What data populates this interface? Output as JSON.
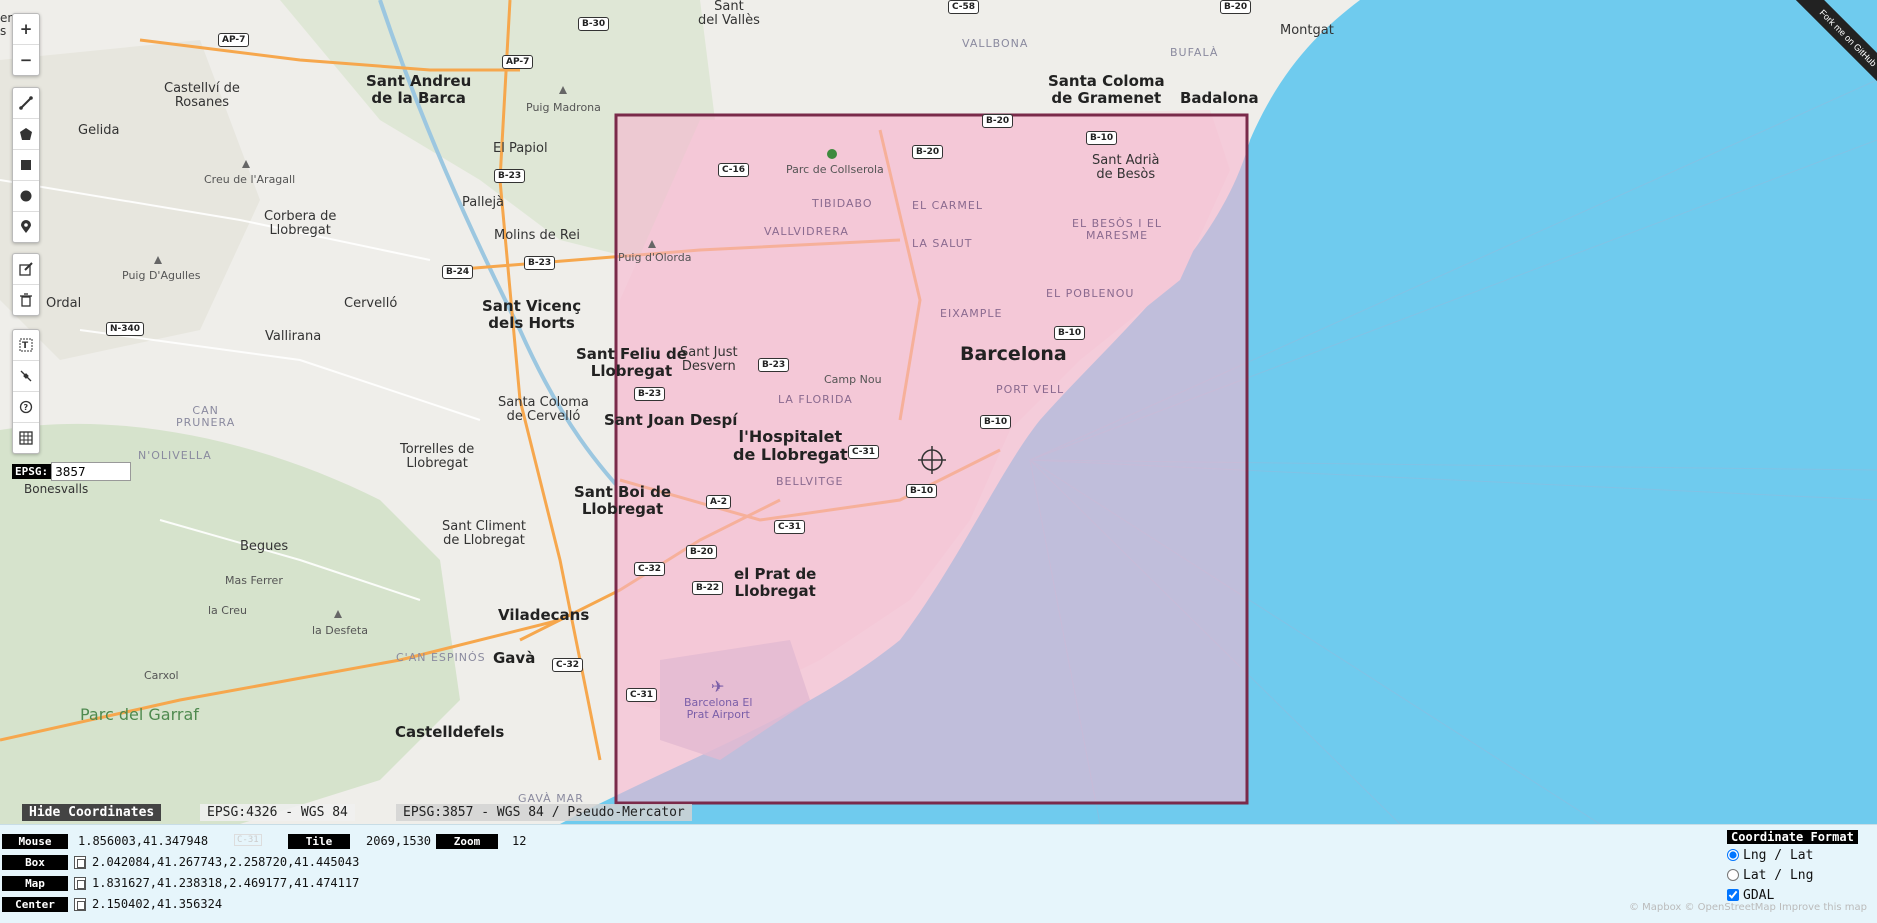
{
  "ribbon": "Fork me on GitHub",
  "zoom_controls": {
    "zoom_in": "+",
    "zoom_out": "−"
  },
  "toolbar_icons": [
    "polyline-icon",
    "polygon-icon",
    "rectangle-icon",
    "circle-icon",
    "marker-icon",
    "edit-icon",
    "trash-icon",
    "text-box-icon",
    "satellite-icon",
    "help-icon",
    "grid-icon"
  ],
  "epsg": {
    "label": "EPSG:",
    "value": "3857"
  },
  "map": {
    "places": {
      "sant_andreu": "Sant Andreu\nde la Barca",
      "castellvi": "Castellví de\nRosanes",
      "gelida": "Gelida",
      "puig_madrona": "Puig Madrona",
      "el_papiol": "El Papiol",
      "creu_aragall": "Creu de l'Aragall",
      "corbera": "Corbera de\nLlobregat",
      "pallejà": "Pallejà",
      "molins": "Molins de Rei",
      "puig_agulles": "Puig D'Agulles",
      "ordal": "Ordal",
      "cervello": "Cervelló",
      "sant_vicenc": "Sant Vicenç\ndels Horts",
      "vallirana": "Vallirana",
      "can_prunera": "CAN\nPRUNERA",
      "n_olivella": "N'OLIVELLA",
      "santa_coloma_cervello": "Santa Coloma\nde Cervelló",
      "torrelles": "Torrelles de\nLlobregat",
      "bonesvalls": "Bonesvalls",
      "sant_climent": "Sant Climent\nde Llobregat",
      "begues": "Begues",
      "mas_ferrer": "Mas Ferrer",
      "la_creu": "la Creu",
      "la_desfeta": "la Desfeta",
      "carxol": "Carxol",
      "parc_garraf": "Parc del Garraf",
      "viladecans": "Viladecans",
      "can_espinos": "C'AN ESPINÓS",
      "gava": "Gavà",
      "castelldefels": "Castelldefels",
      "gava_mar": "GAVÀ MAR",
      "montgat": "Montgat",
      "sant_vicenc_valles": "Sant\ndel Vallès",
      "vallbona": "VALLBONA",
      "bufala": "BUFALÀ",
      "santa_coloma_gramenet": "Santa Coloma\nde Gramenet",
      "badalona": "Badalona",
      "sant_adria": "Sant Adrià\nde Besòs",
      "parc_collserola": "Parc de Collserola",
      "tibidabo": "TIBIDABO",
      "vallvidrera": "VALLVIDRERA",
      "el_carmel": "EL CARMEL",
      "la_salut": "LA SALUT",
      "el_besos": "EL BESÒS I EL\nMARESME",
      "el_poblenou": "EL POBLENOU",
      "puig_olorda": "Puig d'Olorda",
      "eixample": "EIXAMPLE",
      "barcelona": "Barcelona",
      "sant_feliu": "Sant Feliu de\nLlobregat",
      "sant_just": "Sant Just\nDesvern",
      "camp_nou": "Camp Nou",
      "port_vell": "PORT VELL",
      "la_florida": "LA FLORIDA",
      "sant_joan": "Sant Joan Despí",
      "hospitalet": "l'Hospitalet\nde Llobregat",
      "bellvitge": "BELLVITGE",
      "sant_boi": "Sant Boi de\nLlobregat",
      "el_prat": "el Prat de\nLlobregat",
      "airport": "Barcelona El\nPrat Airport",
      "en_s": "en\ns"
    },
    "roads": [
      "B-30",
      "AP-7",
      "AP-7",
      "C-58",
      "B-20",
      "B-20",
      "B-20",
      "B-10",
      "B-23",
      "C-16",
      "B-23",
      "B-24",
      "N-340",
      "B-23",
      "B-23",
      "B-10",
      "B-10",
      "C-31",
      "B-10",
      "A-2",
      "C-31",
      "B-20",
      "C-32",
      "B-22",
      "C-32",
      "C-31"
    ]
  },
  "coords_tabs": {
    "hide": "Hide Coordinates",
    "wgs84": "EPSG:4326 - WGS 84",
    "mercator": "EPSG:3857 - WGS 84 / Pseudo-Mercator"
  },
  "panel": {
    "mouse_label": "Mouse",
    "mouse_value": "1.856003,41.347948",
    "mouse_extra": "C-31",
    "tile_label": "Tile",
    "tile_value": "2069,1530",
    "zoom_label": "Zoom",
    "zoom_value": "12",
    "box_label": "Box",
    "box_value": "2.042084,41.267743,2.258720,41.445043",
    "map_label": "Map",
    "map_value": "1.831627,41.238318,2.469177,41.474117",
    "center_label": "Center",
    "center_value": "2.150402,41.356324",
    "format_title": "Coordinate Format",
    "format_lnglat": "Lng / Lat",
    "format_latlng": "Lat / Lng",
    "format_gdal": "GDAL",
    "attribution": "© Mapbox © OpenStreetMap Improve this map"
  },
  "colors": {
    "sea": "#6fcbee",
    "box_fill": "#f7b6cf",
    "box_border": "#7a2a4a",
    "panel": "#e6f5fb"
  }
}
